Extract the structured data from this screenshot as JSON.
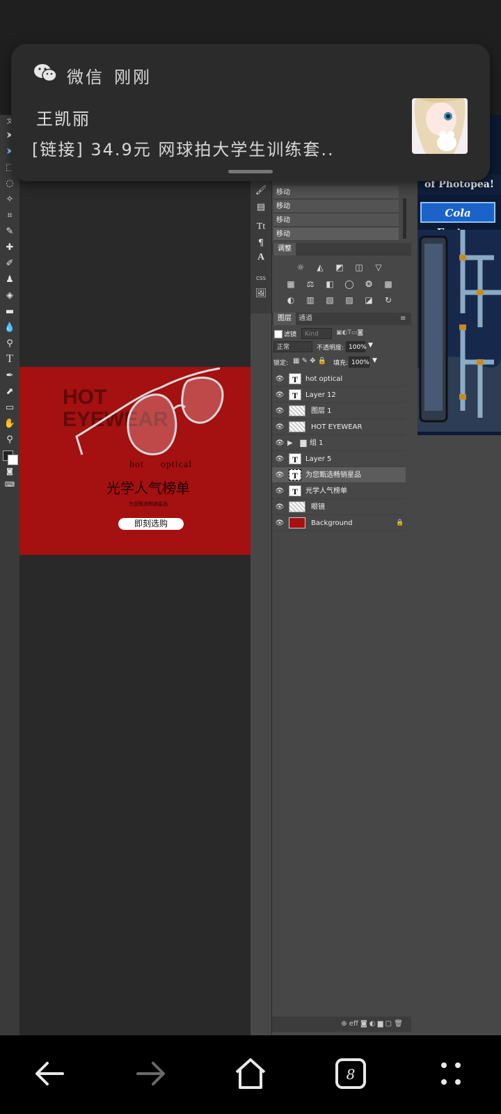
{
  "notification": {
    "app_name": "微信",
    "time": "刚刚",
    "sender": "王凯丽",
    "message": "[链接] 34.9元 网球拍大学生训练套..",
    "colors": {
      "card": "#2b2b2b",
      "wechat_icon": "#e6e6e6"
    }
  },
  "document": {
    "headline": [
      "HOT",
      "EYEWEAR"
    ],
    "sub_left": "hot",
    "sub_right": "optical",
    "title": "光学人气榜单",
    "tagline": "为您甄选畅销星品",
    "cta": "即刻选购",
    "background_color": "#a51010"
  },
  "history": {
    "items": [
      "移动",
      "移动",
      "移动",
      "移动"
    ]
  },
  "adjust_panel": {
    "tab": "调整"
  },
  "layers_panel": {
    "tabs": [
      "图层",
      "通道"
    ],
    "filter_label": "滤镜",
    "filter_kind": "Kind",
    "blend_mode": "正常",
    "opacity_label": "不透明度:",
    "opacity_value": "100%",
    "lock_label": "锁定:",
    "fill_label": "填充:",
    "fill_value": "100%",
    "layers": [
      {
        "name": "hot optical",
        "type": "text"
      },
      {
        "name": "Layer 12",
        "type": "text"
      },
      {
        "name": "图层 1",
        "type": "raster"
      },
      {
        "name": "HOT EYEWEAR",
        "type": "raster"
      },
      {
        "name": "组 1",
        "type": "group"
      },
      {
        "name": "Layer 5",
        "type": "text"
      },
      {
        "name": "为您甄选畅销星品",
        "type": "text",
        "selected": true
      },
      {
        "name": "光学人气榜单",
        "type": "text"
      },
      {
        "name": "眼镜",
        "type": "smart"
      },
      {
        "name": "Background",
        "type": "background",
        "locked": true
      }
    ],
    "footer_icons": "⊕ eff ◙ ◐ ▆ ▢ 🗑"
  },
  "ad": {
    "top_text": "of Photopea!",
    "title": "Cola Factory"
  }
}
